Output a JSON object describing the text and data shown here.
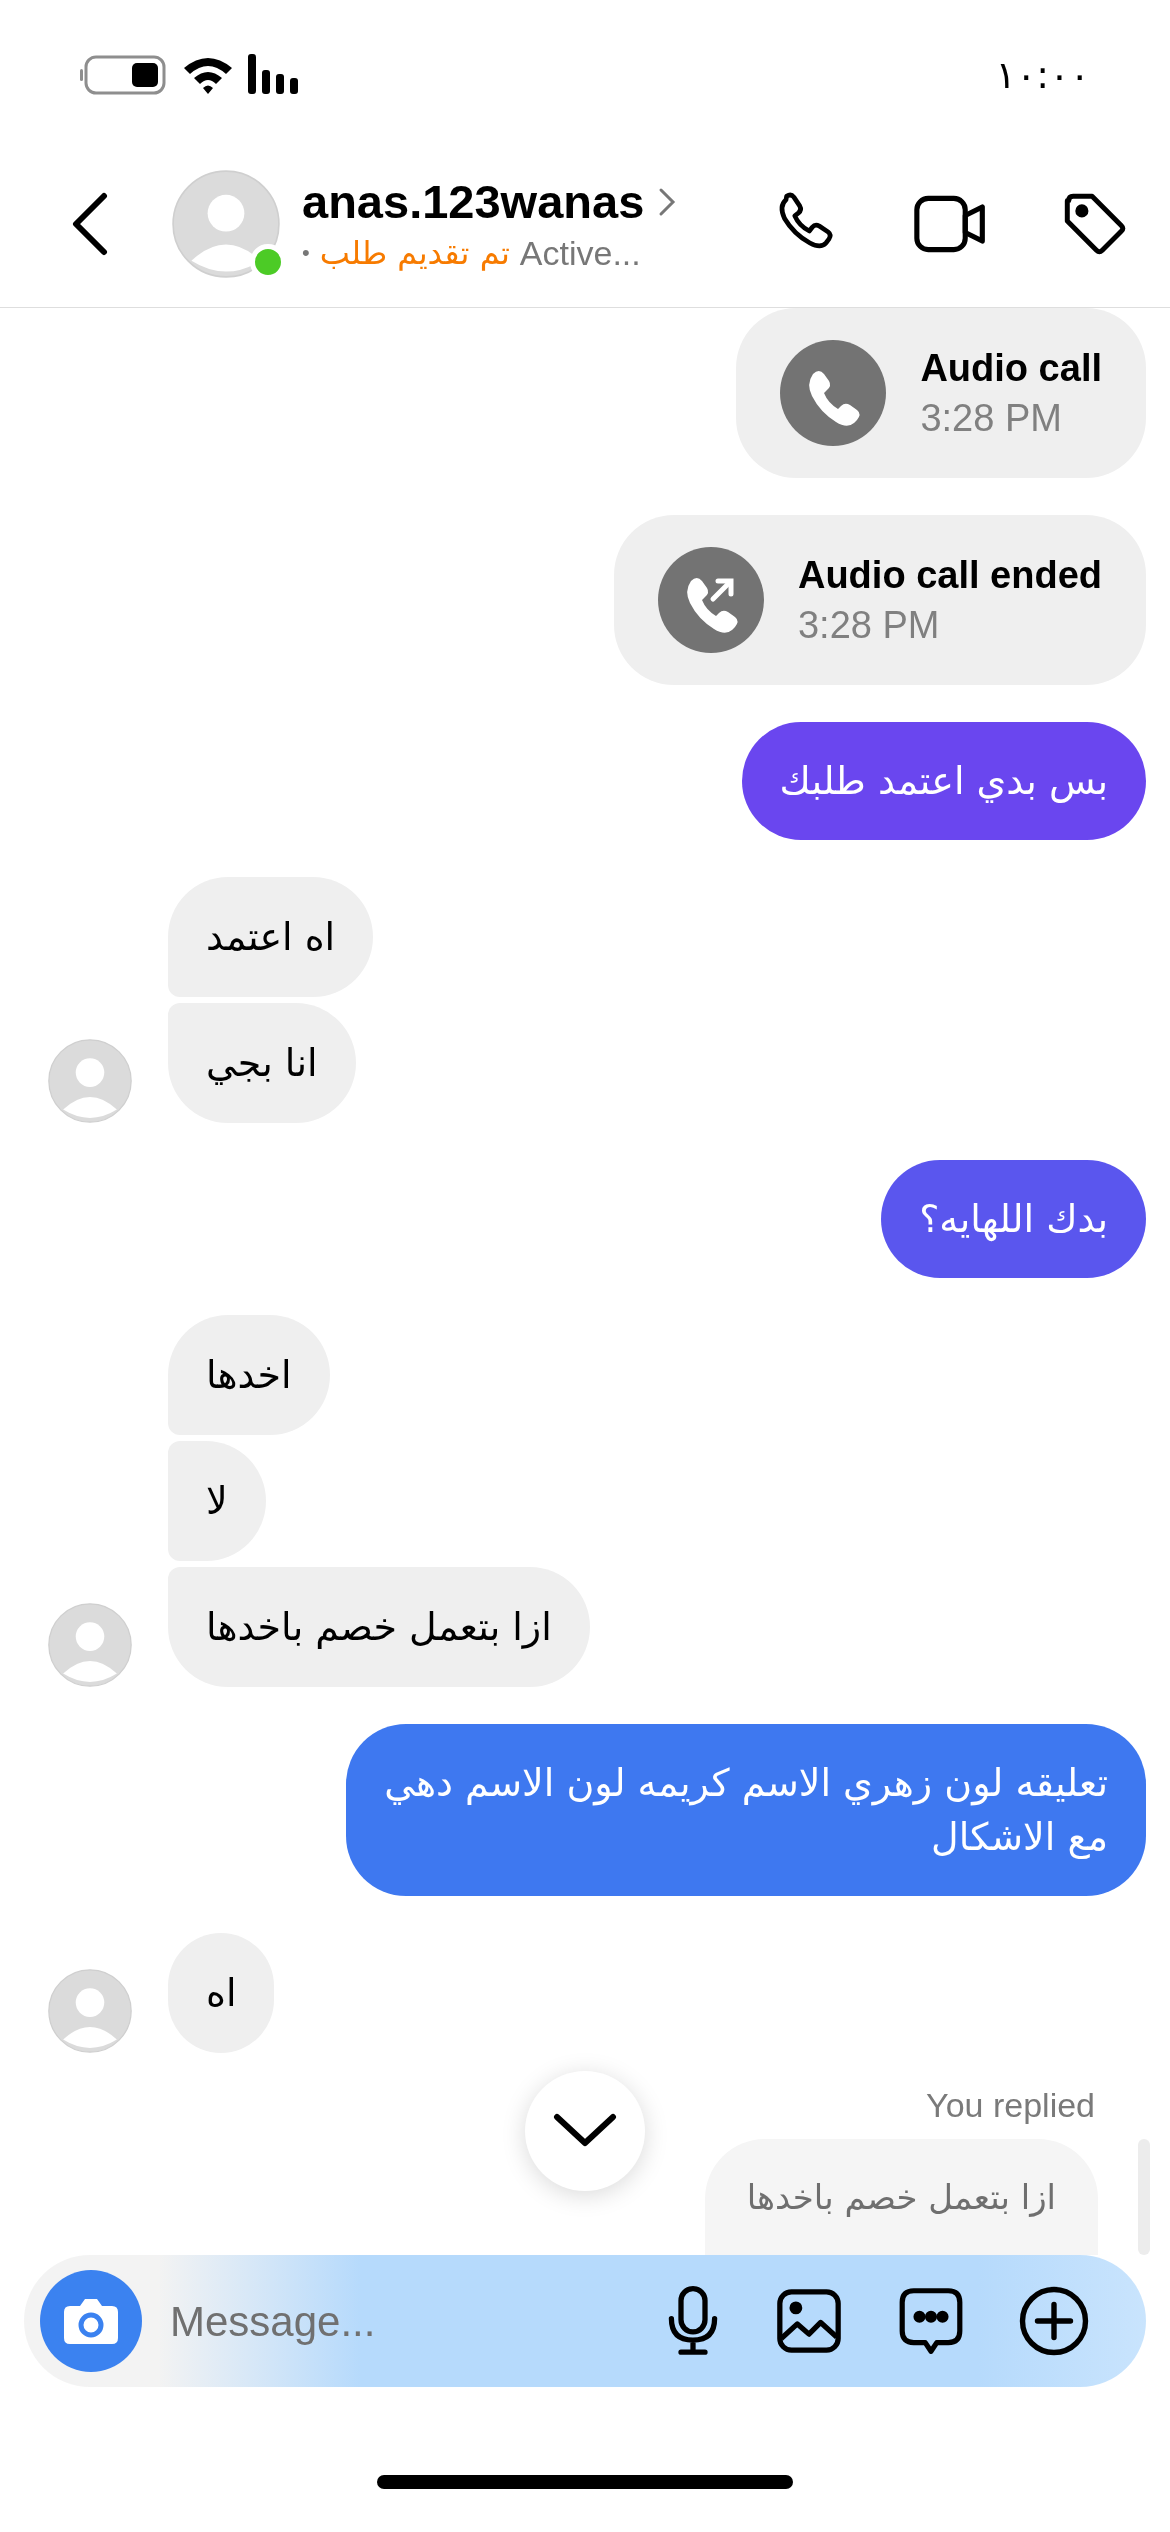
{
  "status_bar": {
    "time": "١٠:٠٠"
  },
  "header": {
    "username": "anas.123wanas",
    "online": true,
    "separator": "•",
    "badge": "تم تقديم طلب",
    "activity": "Active..."
  },
  "messages": [
    {
      "kind": "call",
      "title": "Audio call",
      "time": "3:28 PM",
      "ended": false
    },
    {
      "kind": "call",
      "title": "Audio call ended",
      "time": "3:28 PM",
      "ended": true
    },
    {
      "kind": "outgoing",
      "text": "بس بدي اعتمد طلبك"
    },
    {
      "kind": "incoming",
      "text": "اه اعتمد",
      "avatar": false
    },
    {
      "kind": "incoming",
      "text": "انا بجي",
      "avatar": true
    },
    {
      "kind": "outgoing",
      "text": "بدك اللهايه؟"
    },
    {
      "kind": "incoming",
      "text": "اخدها",
      "avatar": false
    },
    {
      "kind": "incoming",
      "text": "لا",
      "avatar": false
    },
    {
      "kind": "incoming",
      "text": "ازا بتعمل خصم باخدها",
      "avatar": true
    },
    {
      "kind": "outgoing",
      "text": "تعليقه لون زهري الاسم كريمه لون الاسم دهي مع الاشكال"
    },
    {
      "kind": "incoming",
      "text": "اه",
      "avatar": true
    }
  ],
  "reply": {
    "label": "You replied",
    "quoted": "ازا بتعمل خصم باخدها"
  },
  "composer": {
    "placeholder": "Message..."
  }
}
